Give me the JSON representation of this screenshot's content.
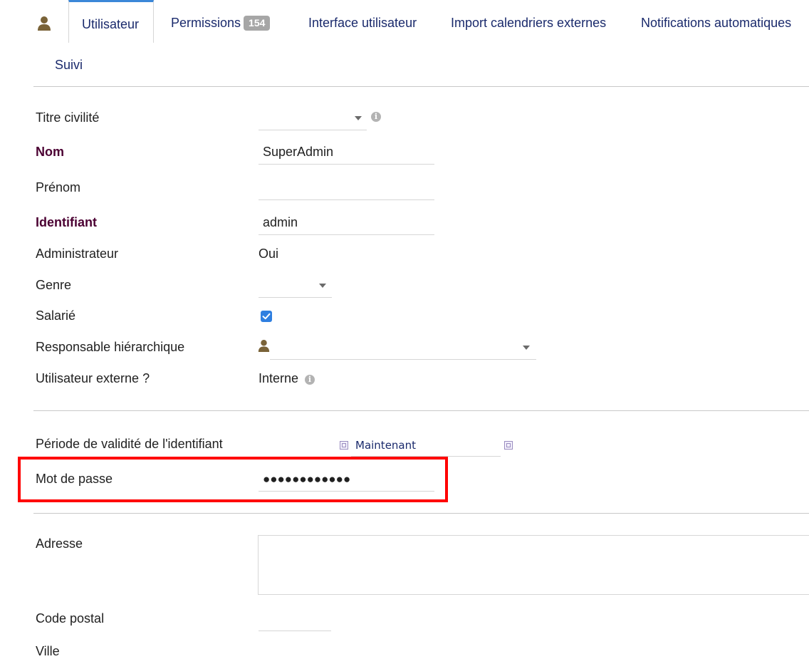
{
  "tabs": {
    "user_icon": "user-icon",
    "items": [
      {
        "label": "Utilisateur",
        "active": true
      },
      {
        "label": "Permissions",
        "badge": "154"
      },
      {
        "label": "Interface utilisateur"
      },
      {
        "label": "Import calendriers externes"
      },
      {
        "label": "Notifications automatiques"
      },
      {
        "label": "Suivi"
      }
    ]
  },
  "form": {
    "titre_civilite": {
      "label": "Titre civilité",
      "value": ""
    },
    "nom": {
      "label": "Nom",
      "value": "SuperAdmin"
    },
    "prenom": {
      "label": "Prénom",
      "value": ""
    },
    "identifiant": {
      "label": "Identifiant",
      "value": "admin"
    },
    "administrateur": {
      "label": "Administrateur",
      "value": "Oui"
    },
    "genre": {
      "label": "Genre",
      "value": ""
    },
    "salarie": {
      "label": "Salarié",
      "checked": true
    },
    "responsable": {
      "label": "Responsable hiérarchique",
      "value": ""
    },
    "externe": {
      "label": "Utilisateur externe ?",
      "value": "Interne"
    },
    "validite": {
      "label": "Période de validité de l'identifiant",
      "start": "Maintenant",
      "end": ""
    },
    "password": {
      "label": "Mot de passe",
      "value": "●●●●●●●●●●●●"
    },
    "adresse": {
      "label": "Adresse",
      "value": ""
    },
    "code_postal": {
      "label": "Code postal",
      "value": ""
    },
    "ville": {
      "label": "Ville",
      "value": ""
    }
  },
  "colors": {
    "tab_text": "#1a2a6c",
    "active_tab_border": "#3b87d8",
    "required_label": "#4b0032",
    "checkbox": "#2f7fe0",
    "highlight": "#ff0000",
    "badge": "#a6a6a6"
  }
}
